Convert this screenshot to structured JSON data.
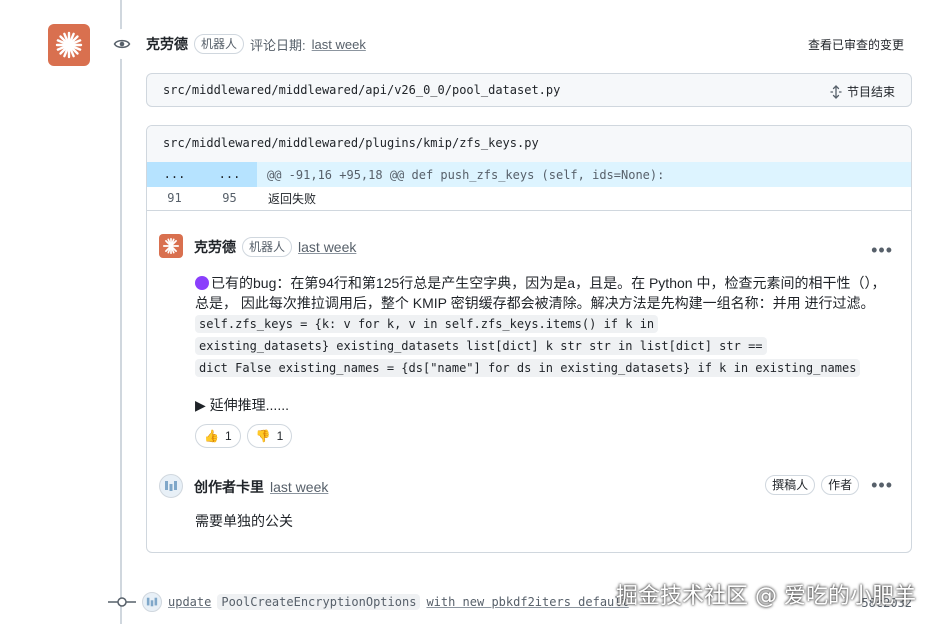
{
  "review": {
    "author": "克劳德",
    "bot_badge": "机器人",
    "review_date_label": "评论日期:",
    "review_date": "last week",
    "view_changes": "查看已审查的变更"
  },
  "file1": {
    "path": "src/middlewared/middlewared/api/v26_0_0/pool_dataset.py",
    "collapse_label": "节目结束"
  },
  "thread": {
    "path": "src/middlewared/middlewared/plugins/kmip/zfs_keys.py",
    "hunk": {
      "old_dots": "...",
      "new_dots": "...",
      "header": "@@ -91,16 +95,18 @@ def push_zfs_keys (self,  ids=None):"
    },
    "context_line": {
      "old_num": "91",
      "new_num": "95",
      "code": "返回失败"
    }
  },
  "comment1": {
    "author": "克劳德",
    "bot_badge": "机器人",
    "time": "last week",
    "more": "•••",
    "text_line1": "已有的bug：在第94行和第125行总是产生空字典，因为是a，且是。在 Python 中，检查元素间的相干性（），",
    "text_line2": "总是， 因此每次推拉调用后，整个 KMIP 密钥缓存都会被清除。解决方法是先构建一组名称：并用 进行过滤。",
    "code_line1": "self.zfs_keys = {k: v for k, v in self.zfs_keys.items() if k in",
    "code_line2": "existing_datasets} existing_datasets list[dict] k str str in list[dict] str ==",
    "code_line3": "dict False existing_names = {ds[\"name\"] for ds in existing_datasets} if k in existing_names",
    "details_label": "▶ 延伸推理......",
    "reactions": [
      {
        "emoji": "👍",
        "count": "1"
      },
      {
        "emoji": "👎",
        "count": "1"
      }
    ]
  },
  "comment2": {
    "author": "创作者卡里",
    "time": "last week",
    "role1": "撰稿人",
    "role2": "作者",
    "more": "•••",
    "text": "需要单独的公关"
  },
  "commit": {
    "prefix": "update",
    "chip": "PoolCreateEncryptionOptions",
    "suffix": "with new pbkdf2iters default",
    "sha": "58c2032"
  },
  "watermark": "掘金技术社区 @ 爱吃的小肥羊",
  "colors": {
    "accent": "#d9704f",
    "hunk_bg": "#ddf4ff",
    "hunk_num_bg": "#b6e3ff",
    "border": "#d0d7de"
  }
}
